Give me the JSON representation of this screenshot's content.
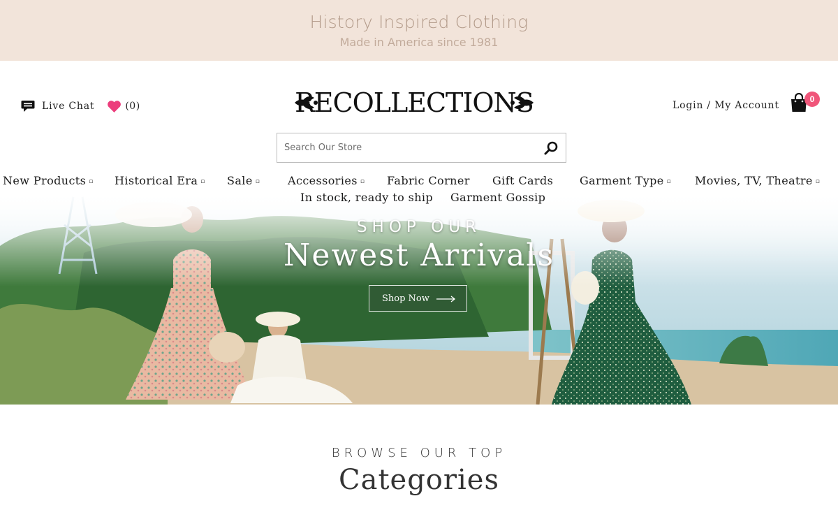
{
  "banner": {
    "title": "History Inspired Clothing",
    "subtitle": "Made in America since 1981"
  },
  "header": {
    "live_chat": "Live Chat",
    "wishlist_count": "(0)",
    "logo_text": "RECOLLECTIONS",
    "account": "Login / My Account",
    "cart_count": "0"
  },
  "search": {
    "placeholder": "Search Our Store"
  },
  "nav": {
    "items": [
      {
        "label": "New Products",
        "dropdown": true
      },
      {
        "label": "Historical Era",
        "dropdown": true
      },
      {
        "label": "Sale",
        "dropdown": true
      },
      {
        "label": "Accessories",
        "dropdown": true
      },
      {
        "label": "Fabric Corner",
        "dropdown": false
      },
      {
        "label": "Gift Cards",
        "dropdown": false
      },
      {
        "label": "Garment Type",
        "dropdown": true
      },
      {
        "label": "Movies, TV, Theatre",
        "dropdown": true
      },
      {
        "label": "In stock, ready to ship",
        "dropdown": false
      },
      {
        "label": "Garment Gossip",
        "dropdown": false
      }
    ],
    "dropdown_glyph": "▫"
  },
  "hero": {
    "kicker": "SHOP OUR",
    "title": "Newest Arrivals",
    "button": "Shop Now"
  },
  "browse": {
    "kicker": "BROWSE OUR TOP",
    "title": "Categories"
  },
  "colors": {
    "banner_bg": "#f2e4da",
    "banner_text": "#b39b8a",
    "heart": "#ec3d7c",
    "cart_badge": "#f0567a"
  },
  "icons": {
    "chat": "chat-bubble-icon",
    "wishlist": "heart-icon",
    "cart": "shopping-bag-icon",
    "search": "magnifier-icon",
    "button_arrow": "long-arrow-right-icon"
  }
}
